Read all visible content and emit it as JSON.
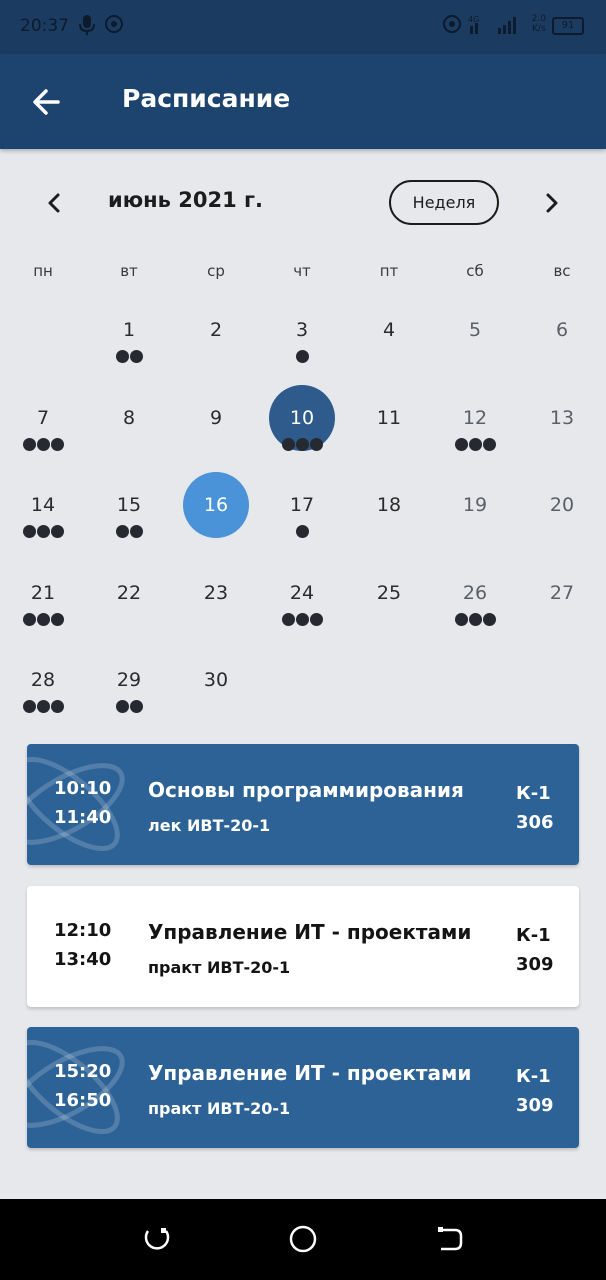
{
  "status_bar": {
    "time": "20:37",
    "net_speed_value": "2.0",
    "net_speed_unit": "K/s",
    "battery": "91",
    "network": "4G"
  },
  "app_bar": {
    "title": "Расписание",
    "back_icon": "arrow-left-icon"
  },
  "calendar": {
    "month_label": "июнь 2021 г.",
    "view_toggle_label": "Неделя",
    "weekdays": [
      "пн",
      "вт",
      "ср",
      "чт",
      "пт",
      "сб",
      "вс"
    ],
    "selected_day": "10",
    "today": "16",
    "colors": {
      "selected": "#2e5a8c",
      "today": "#4a93d8",
      "dot": "#262a30"
    },
    "weeks": [
      [
        {
          "day": "",
          "dots": 0
        },
        {
          "day": "1",
          "dots": 2
        },
        {
          "day": "2",
          "dots": 0
        },
        {
          "day": "3",
          "dots": 1
        },
        {
          "day": "4",
          "dots": 0
        },
        {
          "day": "5",
          "dots": 0
        },
        {
          "day": "6",
          "dots": 0
        }
      ],
      [
        {
          "day": "7",
          "dots": 3
        },
        {
          "day": "8",
          "dots": 0
        },
        {
          "day": "9",
          "dots": 0
        },
        {
          "day": "10",
          "dots": 3
        },
        {
          "day": "11",
          "dots": 0
        },
        {
          "day": "12",
          "dots": 3
        },
        {
          "day": "13",
          "dots": 0
        }
      ],
      [
        {
          "day": "14",
          "dots": 3
        },
        {
          "day": "15",
          "dots": 2
        },
        {
          "day": "16",
          "dots": 0
        },
        {
          "day": "17",
          "dots": 1
        },
        {
          "day": "18",
          "dots": 0
        },
        {
          "day": "19",
          "dots": 0
        },
        {
          "day": "20",
          "dots": 0
        }
      ],
      [
        {
          "day": "21",
          "dots": 3
        },
        {
          "day": "22",
          "dots": 0
        },
        {
          "day": "23",
          "dots": 0
        },
        {
          "day": "24",
          "dots": 3
        },
        {
          "day": "25",
          "dots": 0
        },
        {
          "day": "26",
          "dots": 3
        },
        {
          "day": "27",
          "dots": 0
        }
      ],
      [
        {
          "day": "28",
          "dots": 3
        },
        {
          "day": "29",
          "dots": 2
        },
        {
          "day": "30",
          "dots": 0
        },
        {
          "day": "",
          "dots": 0
        },
        {
          "day": "",
          "dots": 0
        },
        {
          "day": "",
          "dots": 0
        },
        {
          "day": "",
          "dots": 0
        }
      ]
    ]
  },
  "lessons": [
    {
      "start": "10:10",
      "end": "11:40",
      "subject": "Основы программирования",
      "details": "лек ИВТ-20-1",
      "building": "К-1",
      "room": "306",
      "style": "blue"
    },
    {
      "start": "12:10",
      "end": "13:40",
      "subject": "Управление ИТ - проектами",
      "details": "практ ИВТ-20-1",
      "building": "К-1",
      "room": "309",
      "style": "white"
    },
    {
      "start": "15:20",
      "end": "16:50",
      "subject": "Управление ИТ - проектами",
      "details": "практ ИВТ-20-1",
      "building": "К-1",
      "room": "309",
      "style": "blue"
    }
  ],
  "nav_bar": {
    "buttons": [
      "recents-icon",
      "home-icon",
      "back-icon"
    ]
  }
}
